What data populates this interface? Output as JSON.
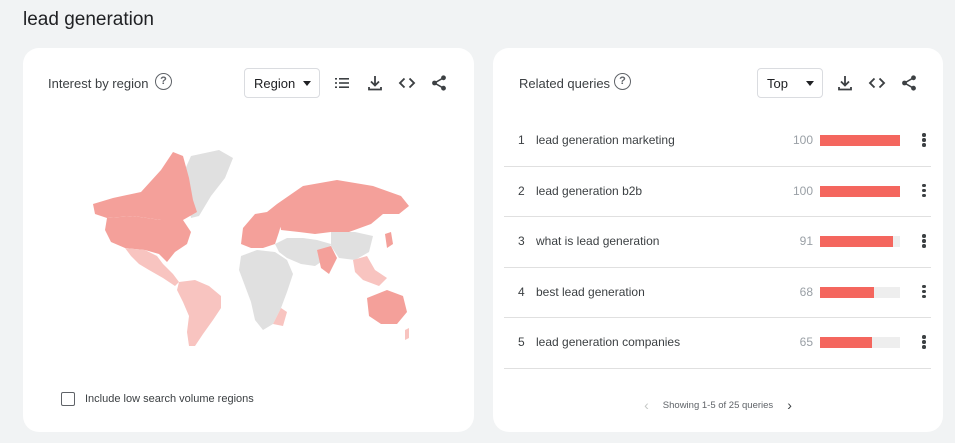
{
  "page_title": "lead generation",
  "region_card": {
    "title": "Interest by region",
    "help_icon": "help-circle-icon",
    "select_value": "Region",
    "tools": [
      "list-icon",
      "download-icon",
      "embed-code-icon",
      "share-icon"
    ],
    "checkbox_label": "Include low search volume regions",
    "checkbox_checked": false,
    "colors": {
      "high": "#f4a09a",
      "mid": "#f8c4c0",
      "none": "#e0e0e0"
    }
  },
  "queries_card": {
    "title": "Related queries",
    "help_icon": "help-circle-icon",
    "select_value": "Top",
    "tools": [
      "download-icon",
      "embed-code-icon",
      "share-icon"
    ],
    "rows": [
      {
        "rank": "1",
        "query": "lead generation marketing",
        "value": "100",
        "level": 100
      },
      {
        "rank": "2",
        "query": "lead generation b2b",
        "value": "100",
        "level": 100
      },
      {
        "rank": "3",
        "query": "what is lead generation",
        "value": "91",
        "level": 91
      },
      {
        "rank": "4",
        "query": "best lead generation",
        "value": "68",
        "level": 68
      },
      {
        "rank": "5",
        "query": "lead generation companies",
        "value": "65",
        "level": 65
      }
    ],
    "pager_text": "Showing 1-5 of 25 queries",
    "bar_color": "#f4665e"
  }
}
